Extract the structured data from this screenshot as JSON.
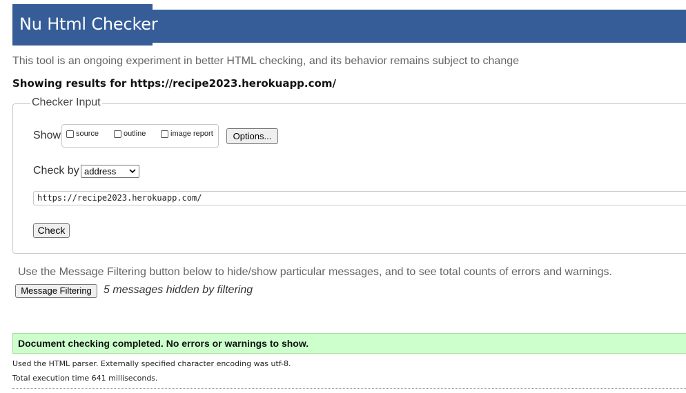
{
  "header": {
    "title": "Nu Html Checker",
    "banner_color": "#365d98"
  },
  "tagline": "This tool is an ongoing experiment in better HTML checking, and its behavior remains subject to change",
  "results": {
    "prefix": "Showing results for ",
    "url": "https://recipe2023.herokuapp.com/"
  },
  "checker_input": {
    "legend": "Checker Input",
    "show_label": "Show",
    "options": [
      {
        "label": "source",
        "checked": false
      },
      {
        "label": "outline",
        "checked": false
      },
      {
        "label": "image report",
        "checked": false
      }
    ],
    "options_button": "Options...",
    "check_by_label": "Check by",
    "check_by_selected": "address",
    "url_value": "https://recipe2023.herokuapp.com/",
    "check_button": "Check"
  },
  "filtering": {
    "hint": "Use the Message Filtering button below to hide/show particular messages, and to see total counts of errors and warnings.",
    "button": "Message Filtering",
    "hidden_messages": "5 messages hidden by filtering"
  },
  "status": {
    "message": "Document checking completed. No errors or warnings to show.",
    "color": "#ccffcc"
  },
  "footer": {
    "parser_note": "Used the HTML parser. Externally specified character encoding was utf-8.",
    "execution_time": "Total execution time 641 milliseconds."
  }
}
